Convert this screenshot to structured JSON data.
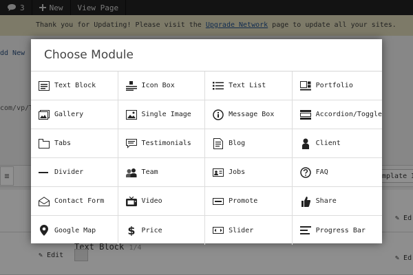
{
  "admin_bar": {
    "comments_count": "3",
    "new_label": "New",
    "view_page_label": "View Page"
  },
  "notice": {
    "before": "Thank you for Updating! Please visit the ",
    "link": "Upgrade Network",
    "after": " page to update all your sites."
  },
  "background": {
    "add_new_fragment": "dd New",
    "url_fragment": "com/vp/T",
    "template_fragment": "mplate I",
    "edit_label": "Edit",
    "edit_fragment": "Ed",
    "text_block_label": "Text Block",
    "text_block_meta": "1/4"
  },
  "modal": {
    "title": "Choose Module",
    "modules": [
      {
        "label": "Text Block",
        "icon": "text-block-icon"
      },
      {
        "label": "Icon Box",
        "icon": "icon-box-icon"
      },
      {
        "label": "Text List",
        "icon": "text-list-icon"
      },
      {
        "label": "Portfolio",
        "icon": "portfolio-icon"
      },
      {
        "label": "Gallery",
        "icon": "gallery-icon"
      },
      {
        "label": "Single Image",
        "icon": "single-image-icon"
      },
      {
        "label": "Message Box",
        "icon": "message-box-icon"
      },
      {
        "label": "Accordion/Toggle",
        "icon": "accordion-toggle-icon"
      },
      {
        "label": "Tabs",
        "icon": "tabs-icon"
      },
      {
        "label": "Testimonials",
        "icon": "testimonials-icon"
      },
      {
        "label": "Blog",
        "icon": "blog-icon"
      },
      {
        "label": "Client",
        "icon": "client-icon"
      },
      {
        "label": "Divider",
        "icon": "divider-icon"
      },
      {
        "label": "Team",
        "icon": "team-icon"
      },
      {
        "label": "Jobs",
        "icon": "jobs-icon"
      },
      {
        "label": "FAQ",
        "icon": "faq-icon"
      },
      {
        "label": "Contact Form",
        "icon": "contact-form-icon"
      },
      {
        "label": "Video",
        "icon": "video-icon"
      },
      {
        "label": "Promote",
        "icon": "promote-icon"
      },
      {
        "label": "Share",
        "icon": "share-icon"
      },
      {
        "label": "Google Map",
        "icon": "google-map-icon"
      },
      {
        "label": "Price",
        "icon": "price-icon"
      },
      {
        "label": "Slider",
        "icon": "slider-icon"
      },
      {
        "label": "Progress Bar",
        "icon": "progress-bar-icon"
      }
    ]
  }
}
